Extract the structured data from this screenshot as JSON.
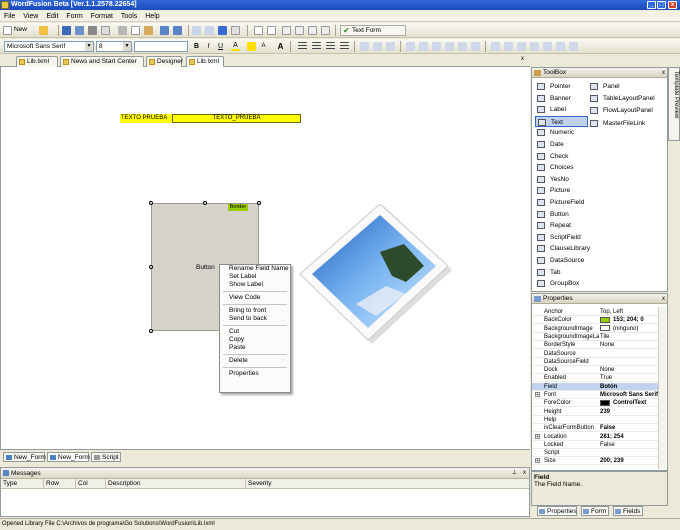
{
  "app": {
    "title": "WordFusion Beta [Ver.1.1.2578.22654]"
  },
  "menu": [
    "File",
    "View",
    "Edit",
    "Form",
    "Format",
    "Tools",
    "Help"
  ],
  "toolbar1": {
    "new_label": "New",
    "text_form_label": "Text Form"
  },
  "toolbar2": {
    "font_name": "Microsoft Sans Serif",
    "font_size": "8"
  },
  "doc_tabs": [
    "Lib.lxml",
    "News and Start Center",
    "Designer",
    "Lib.lxml"
  ],
  "canvas": {
    "label_text": "TEXTO PRUEBA",
    "textbox_text": "TEXTO_PRUEBA",
    "button_text": "Button",
    "border_tag": "Border"
  },
  "context_menu": {
    "group1": [
      "Rename Field Name",
      "Set Label",
      "Show Label"
    ],
    "group2": [
      "View Code"
    ],
    "group3": [
      "Bring to front",
      "Send to back"
    ],
    "group4": [
      "Cut",
      "Copy",
      "Paste"
    ],
    "group5": [
      "Delete"
    ],
    "group6": [
      "Properties"
    ]
  },
  "bottom_tabs": [
    "New_Form",
    "New_Form",
    "Script"
  ],
  "messages": {
    "title": "Messages",
    "columns": [
      "Type",
      "Row",
      "Col",
      "Description",
      "Severity"
    ]
  },
  "status": "Opened Library File C:\\Archivos de programa\\Go Solutions\\WordFusion\\Lib.lxml",
  "toolbox": {
    "title": "ToolBox",
    "col1": [
      "Pointer",
      "Banner",
      "Label",
      "Text",
      "Numeric",
      "Date",
      "Check",
      "Choices",
      "YesNo",
      "Picture",
      "PictureField",
      "Button",
      "Repeat",
      "ScriptField",
      "ClauseLibrary",
      "DataSource",
      "Tab",
      "GroupBox"
    ],
    "col2": [
      "Panel",
      "TableLayoutPanel",
      "FlowLayoutPanel",
      "MasterFileLink"
    ],
    "selected": "Text"
  },
  "side_tab": "Template Preview",
  "properties": {
    "title": "Properties",
    "rows": [
      {
        "name": "Anchor",
        "value": "Top, Left",
        "ex": ""
      },
      {
        "name": "BackColor",
        "value": "153; 204; 0",
        "ex": "",
        "swatch": "#99cc00",
        "bold": true
      },
      {
        "name": "BackgroundImage",
        "value": "(ninguno)",
        "ex": "",
        "swatch": "#ffffff"
      },
      {
        "name": "BackgroundImageLa",
        "value": "Tile",
        "ex": ""
      },
      {
        "name": "BorderStyle",
        "value": "None",
        "ex": ""
      },
      {
        "name": "DataSource",
        "value": "",
        "ex": ""
      },
      {
        "name": "DataSourceField",
        "value": "",
        "ex": ""
      },
      {
        "name": "Dock",
        "value": "None",
        "ex": ""
      },
      {
        "name": "Enabled",
        "value": "True",
        "ex": ""
      },
      {
        "name": "Field",
        "value": "Botón",
        "ex": "",
        "bold": true,
        "sel": true
      },
      {
        "name": "Font",
        "value": "Microsoft Sans Serif",
        "ex": "+",
        "bold": true
      },
      {
        "name": "ForeColor",
        "value": "ControlText",
        "ex": "",
        "swatch": "#000000",
        "bold": true
      },
      {
        "name": "Height",
        "value": "239",
        "ex": "",
        "bold": true
      },
      {
        "name": "Help",
        "value": "",
        "ex": ""
      },
      {
        "name": "isClearFormButton",
        "value": "False",
        "ex": "",
        "bold": true
      },
      {
        "name": "Location",
        "value": "281; 254",
        "ex": "+",
        "bold": true
      },
      {
        "name": "Locked",
        "value": "False",
        "ex": ""
      },
      {
        "name": "Script",
        "value": "",
        "ex": ""
      },
      {
        "name": "Size",
        "value": "200; 239",
        "ex": "+",
        "bold": true
      }
    ]
  },
  "description": {
    "title": "Field",
    "text": "The Field Name."
  },
  "panel_tabs": [
    "Properties",
    "Form",
    "Fields"
  ]
}
